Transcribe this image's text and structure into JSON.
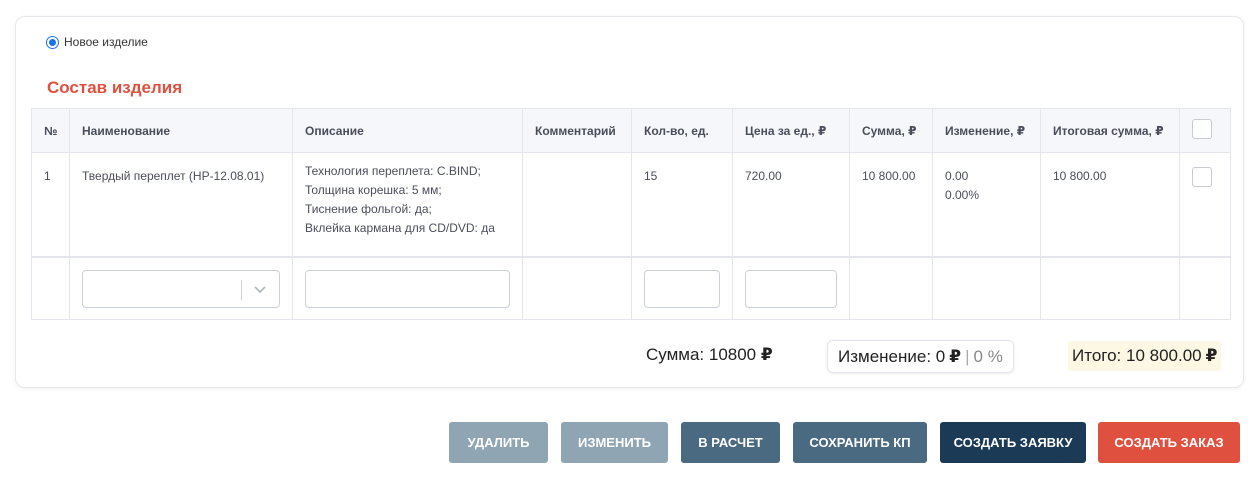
{
  "radio": {
    "label": "Новое изделие",
    "checked": true
  },
  "section_title": "Состав изделия",
  "table": {
    "headers": {
      "num": "№",
      "name": "Наименование",
      "desc": "Описание",
      "comment": "Комментарий",
      "qty": "Кол-во, ед.",
      "price": "Цена за ед., ₽",
      "sum": "Сумма, ₽",
      "change": "Изменение, ₽",
      "total": "Итоговая сумма, ₽"
    },
    "rows": [
      {
        "num": "1",
        "name": "Твердый переплет (HP-12.08.01)",
        "desc_lines": [
          "Технология переплета: C.BIND;",
          "Толщина корешка: 5 мм;",
          "Тиснение фольгой: да;",
          "Вклейка кармана для CD/DVD: да"
        ],
        "comment": "",
        "qty": "15",
        "price": "720.00",
        "sum": "10 800.00",
        "change_abs": "0.00",
        "change_pct": "0.00%",
        "total": "10 800.00"
      }
    ]
  },
  "summary": {
    "sum_label": "Сумма: 10800",
    "change_label": "Изменение: 0",
    "change_pct": "0 %",
    "final_label": "Итого: 10 800.00",
    "currency": "₽"
  },
  "buttons": {
    "delete": "Удалить",
    "edit": "Изменить",
    "calc": "В расчет",
    "save": "Сохранить КП",
    "request": "Создать заявку",
    "order": "Создать заказ"
  },
  "colors": {
    "accent_red": "#e0503f",
    "button_muted": "#8fa5b3",
    "button_slate": "#4a6a82",
    "button_navy": "#1b3a56",
    "radio_blue": "#1a73e8"
  }
}
